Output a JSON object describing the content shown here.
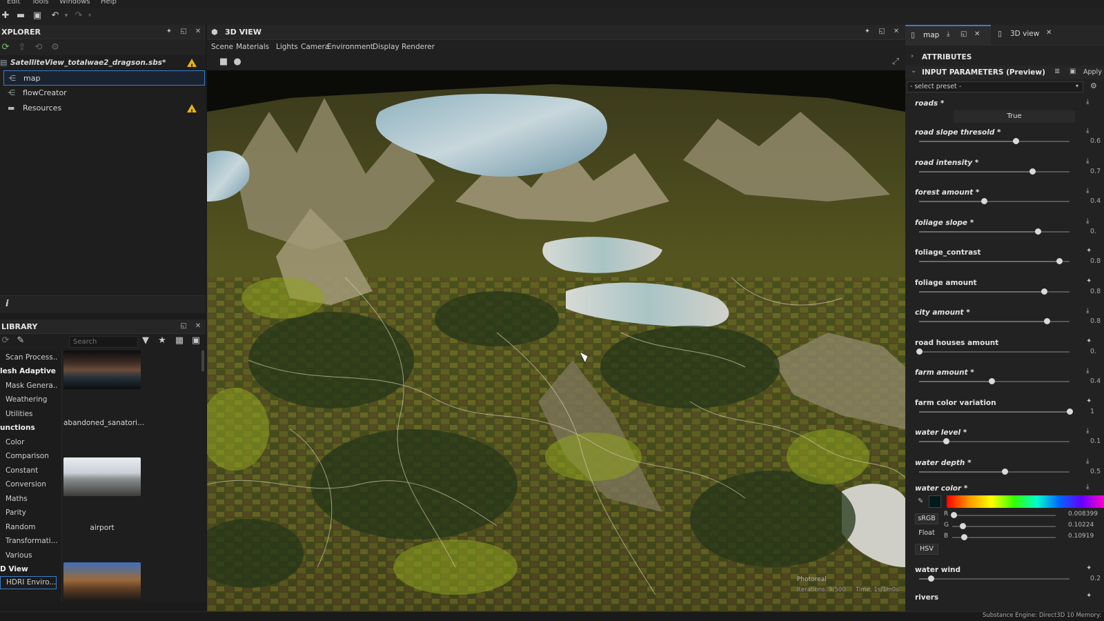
{
  "menubar": {
    "items": [
      "Edit",
      "Tools",
      "Windows",
      "Help"
    ]
  },
  "explorer": {
    "title": "XPLORER",
    "package_name": "SatelliteView_totalwae2_dragson.sbs*",
    "items": [
      {
        "label": "map",
        "selected": true
      },
      {
        "label": "flowCreator"
      },
      {
        "label": "Resources",
        "warning": true
      }
    ],
    "info_glyph": "i"
  },
  "library": {
    "title": "LIBRARY",
    "search_placeholder": "Search",
    "categories": [
      {
        "label": "Scan Process...",
        "bold": false
      },
      {
        "label": "lesh Adaptive",
        "bold": true
      },
      {
        "label": "Mask Genera...",
        "bold": false
      },
      {
        "label": "Weathering",
        "bold": false
      },
      {
        "label": "Utilities",
        "bold": false
      },
      {
        "label": "unctions",
        "bold": true
      },
      {
        "label": "Color",
        "bold": false
      },
      {
        "label": "Comparison",
        "bold": false
      },
      {
        "label": "Constant",
        "bold": false
      },
      {
        "label": "Conversion",
        "bold": false
      },
      {
        "label": "Maths",
        "bold": false
      },
      {
        "label": "Parity",
        "bold": false
      },
      {
        "label": "Random",
        "bold": false
      },
      {
        "label": "Transformati...",
        "bold": false
      },
      {
        "label": "Various",
        "bold": false
      },
      {
        "label": "D View",
        "bold": true
      },
      {
        "label": "HDRI Enviro...",
        "bold": false,
        "selected": true
      }
    ],
    "thumbnails": [
      {
        "label": "abandoned_sanatori..."
      },
      {
        "label": "airport"
      },
      {
        "label": ""
      }
    ]
  },
  "view3d": {
    "title": "3D VIEW",
    "menu": [
      "Scene",
      "Materials",
      "Lights",
      "Camera",
      "Environment",
      "Display",
      "Renderer"
    ],
    "overlay": {
      "renderer": "Photoreal",
      "iterations": "Iterations: 9/500",
      "time": "Time: 1s/1m0s"
    }
  },
  "right_panel": {
    "tabs": [
      {
        "label": "map"
      },
      {
        "label": "3D view"
      }
    ],
    "sections": {
      "attributes": "ATTRIBUTES",
      "input_parameters": "INPUT PARAMETERS (Preview)",
      "apply": "Apply"
    },
    "preset_placeholder": "- select preset -",
    "params": [
      {
        "label": "roads *",
        "italic": true,
        "type": "bool",
        "value": "True"
      },
      {
        "label": "road slope thresold *",
        "italic": true,
        "level": 0.64,
        "value": "0.6"
      },
      {
        "label": "road intensity *",
        "italic": true,
        "level": 0.75,
        "value": "0.7"
      },
      {
        "label": "forest amount *",
        "italic": true,
        "level": 0.43,
        "value": "0.4"
      },
      {
        "label": "foliage slope *",
        "italic": true,
        "level": 0.79,
        "value": "0."
      },
      {
        "label": "foliage_contrast",
        "italic": false,
        "level": 0.93,
        "value": "0.8"
      },
      {
        "label": "foliage amount",
        "italic": false,
        "level": 0.83,
        "value": "0.8"
      },
      {
        "label": "city amount *",
        "italic": true,
        "level": 0.85,
        "value": "0.8"
      },
      {
        "label": "road houses amount",
        "italic": false,
        "level": 0.0,
        "value": "0."
      },
      {
        "label": "farm amount *",
        "italic": true,
        "level": 0.48,
        "value": "0.4"
      },
      {
        "label": "farm color variation",
        "italic": false,
        "level": 1.0,
        "value": "1"
      },
      {
        "label": "water level *",
        "italic": true,
        "level": 0.18,
        "value": "0.1"
      },
      {
        "label": "water depth *",
        "italic": true,
        "level": 0.57,
        "value": "0.5"
      }
    ],
    "water_color": {
      "label": "water color *",
      "modes": [
        "sRGB",
        "Float",
        "HSV"
      ],
      "channels": [
        {
          "name": "R",
          "value": "0.008399",
          "level": 0.01
        },
        {
          "name": "G",
          "value": "0.10224",
          "level": 0.1
        },
        {
          "name": "B",
          "value": "0.10919",
          "level": 0.11
        }
      ]
    },
    "water_wind": {
      "label": "water wind",
      "level": 0.08,
      "value": "0.2"
    },
    "rivers": {
      "label": "rivers"
    }
  },
  "statusbar": {
    "text": "Substance Engine: Direct3D 10  Memory:"
  }
}
